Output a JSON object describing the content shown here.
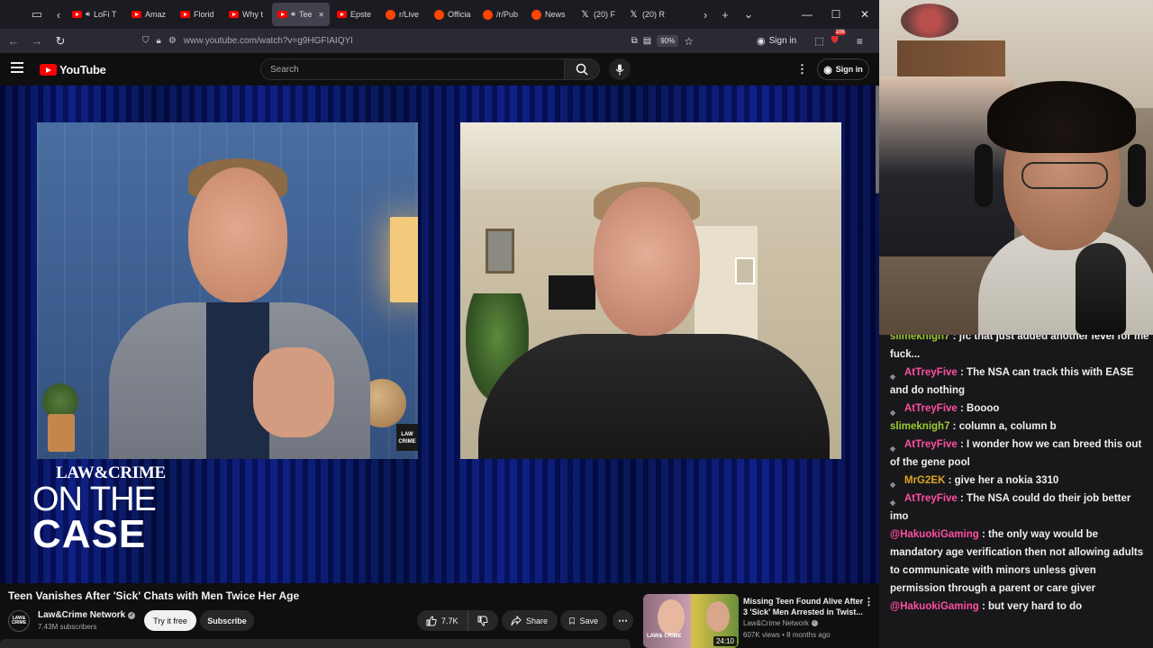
{
  "browser": {
    "tabs": [
      {
        "label": "LoFi T",
        "icon": "youtube",
        "audio": true
      },
      {
        "label": "Amaz",
        "icon": "youtube",
        "audio": false
      },
      {
        "label": "Florid",
        "icon": "youtube",
        "audio": false
      },
      {
        "label": "Why t",
        "icon": "youtube",
        "audio": false
      },
      {
        "label": "Tee",
        "icon": "youtube",
        "audio": true,
        "active": true
      },
      {
        "label": "Epste",
        "icon": "youtube",
        "audio": false
      },
      {
        "label": "r/Live",
        "icon": "reddit",
        "audio": false
      },
      {
        "label": "Officia",
        "icon": "reddit",
        "audio": false
      },
      {
        "label": "/r/Pub",
        "icon": "reddit",
        "audio": false
      },
      {
        "label": "News",
        "icon": "reddit",
        "audio": false
      },
      {
        "label": "(20) F",
        "icon": "x",
        "audio": false
      },
      {
        "label": "(20) R",
        "icon": "x",
        "audio": false
      }
    ],
    "url": "www.youtube.com/watch?v=g9HGFIAIQYI",
    "zoom": "90%",
    "sign_in": "Sign in",
    "notification_count": "106"
  },
  "youtube": {
    "logo_text": "YouTube",
    "search_placeholder": "Search",
    "sign_in": "Sign in"
  },
  "video": {
    "brand_top": "LAW&CRIME",
    "brand_mid": "ON THE",
    "brand_bot": "CASE",
    "bug_text": "LAW CRIME"
  },
  "watch": {
    "title": "Teen Vanishes After 'Sick' Chats with Men Twice Her Age",
    "channel": "Law&Crime Network",
    "subscribers": "7.43M subscribers",
    "avatar_text": "LAW& CRIME",
    "try_it_free": "Try it free",
    "subscribe": "Subscribe",
    "likes": "7.7K",
    "share": "Share",
    "save": "Save"
  },
  "recommended": {
    "title": "Missing Teen Found Alive After 3 'Sick' Men Arrested in Twist...",
    "channel": "Law&Crime Network",
    "meta": "607K views • 8 months ago",
    "duration": "24:10",
    "thumb_logo": "LAW& CRIME"
  },
  "chat": {
    "messages": [
      {
        "user": "slimeknigh7",
        "color": "#9acd32",
        "text": "jfc that just added another level for me fuck...",
        "badge": false
      },
      {
        "user": "AtTreyFive",
        "color": "#ff4fa0",
        "text": "The NSA can track this with EASE and do nothing",
        "badge": true
      },
      {
        "user": "AtTreyFive",
        "color": "#ff4fa0",
        "text": "Boooo",
        "badge": true
      },
      {
        "user": "slimeknigh7",
        "color": "#9acd32",
        "text": "column a, column b",
        "badge": false
      },
      {
        "user": "AtTreyFive",
        "color": "#ff4fa0",
        "text": "I wonder how we can breed this out of the gene pool",
        "badge": true
      },
      {
        "user": "MrG2EK",
        "color": "#daa520",
        "text": "give her a nokia 3310",
        "badge": true
      },
      {
        "user": "AtTreyFive",
        "color": "#ff4fa0",
        "text": "The NSA could do their job better imo",
        "badge": true
      },
      {
        "user": "@HakuokiGaming",
        "color": "#ff4fa0",
        "text": "the only way would be mandatory age verification then not allowing adults to communicate with minors unless given permission through a parent or care giver",
        "badge": false
      },
      {
        "user": "@HakuokiGaming",
        "color": "#ff4fa0",
        "text": "but very hard to do",
        "badge": false
      }
    ]
  }
}
